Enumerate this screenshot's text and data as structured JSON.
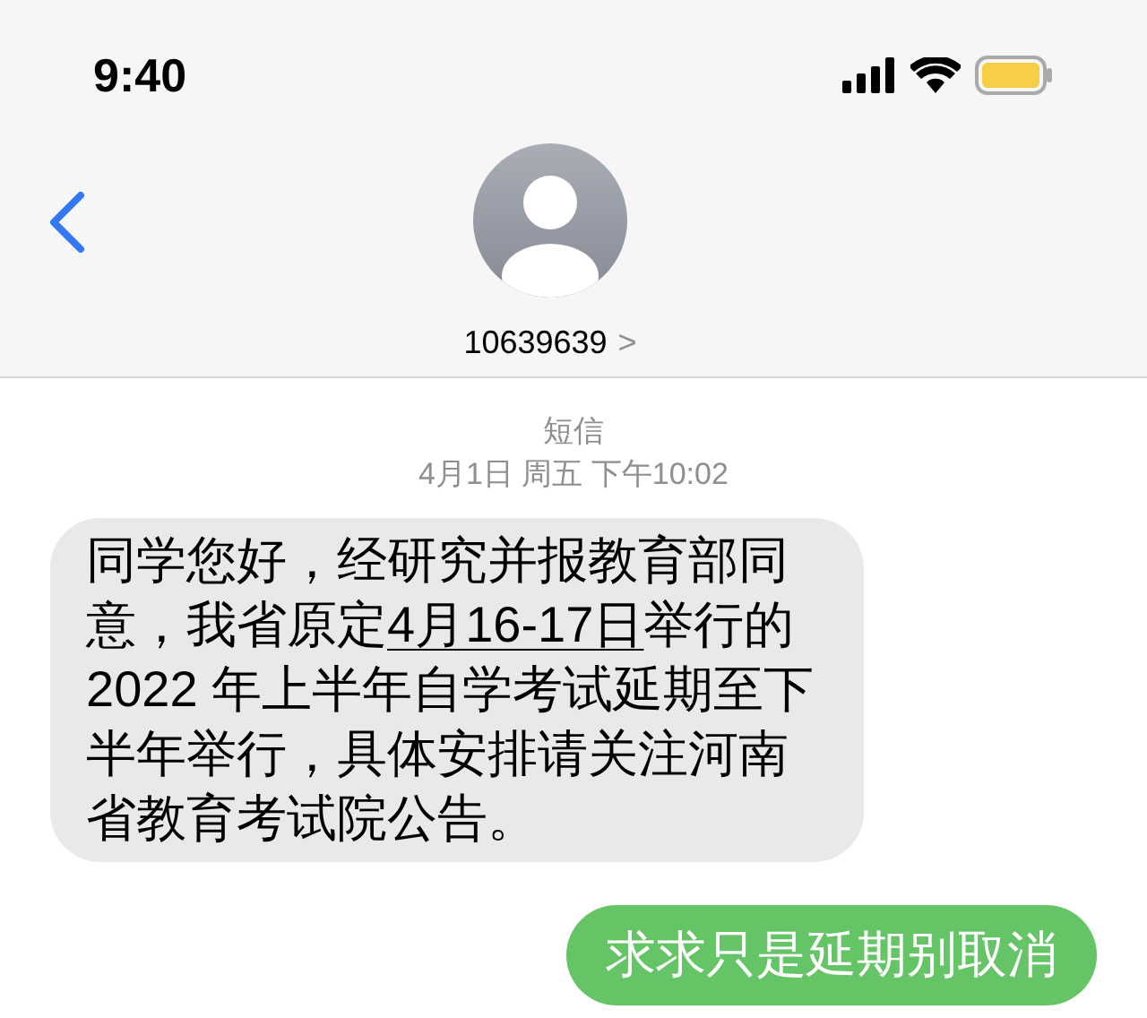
{
  "status_bar": {
    "time": "9:40"
  },
  "header": {
    "contact": "10639639",
    "chevron": ">"
  },
  "thread": {
    "service": "短信",
    "timestamp": "4月1日 周五 下午10:02"
  },
  "messages": [
    {
      "kind": "received",
      "parts": [
        {
          "text": "同学您好，经研究并报教育部同意，我省原定",
          "underlined": false
        },
        {
          "text": "4月16-17日",
          "underlined": true
        },
        {
          "text": "举行的 2022 年上半年自学考试延期至下半年举行，具体安排请关注河南省教育考试院公告。",
          "underlined": false
        }
      ]
    },
    {
      "kind": "sent",
      "parts": [
        {
          "text": "求求只是延期别取消",
          "underlined": false
        }
      ]
    }
  ]
}
